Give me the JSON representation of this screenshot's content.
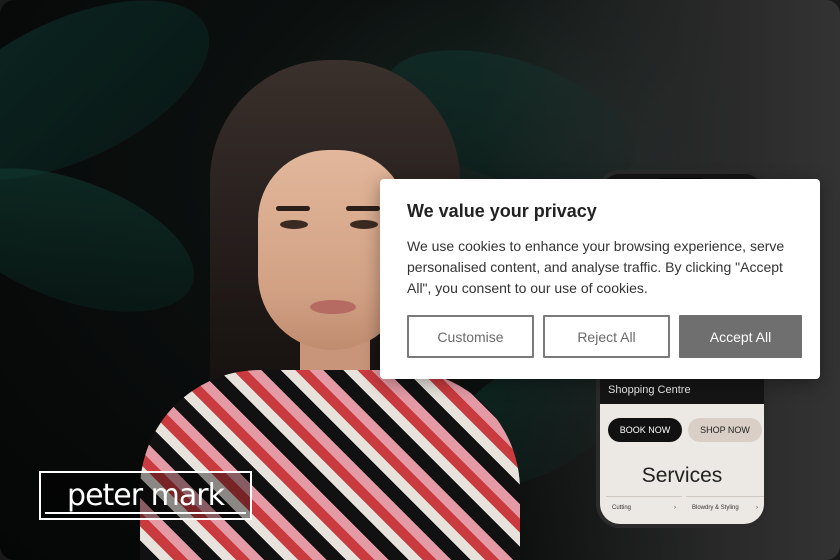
{
  "brand": {
    "logo_text": "peter mark"
  },
  "phone": {
    "location": "Shopping Centre",
    "book_label": "BOOK NOW",
    "shop_label": "SHOP NOW",
    "services_title": "Services",
    "service_items": [
      {
        "label": "Cutting",
        "chevron": "›"
      },
      {
        "label": "Blowdry & Styling",
        "chevron": "›"
      }
    ]
  },
  "cookie_banner": {
    "title": "We value your privacy",
    "body": "We use cookies to enhance your browsing experience, serve personalised content, and analyse traffic. By clicking \"Accept All\", you consent to our use of cookies.",
    "buttons": {
      "customise": "Customise",
      "reject": "Reject All",
      "accept": "Accept All"
    }
  },
  "colors": {
    "accept_button": "#6f6f6f",
    "outline_border": "#7a7a7a",
    "dialog_bg": "#ffffff"
  }
}
